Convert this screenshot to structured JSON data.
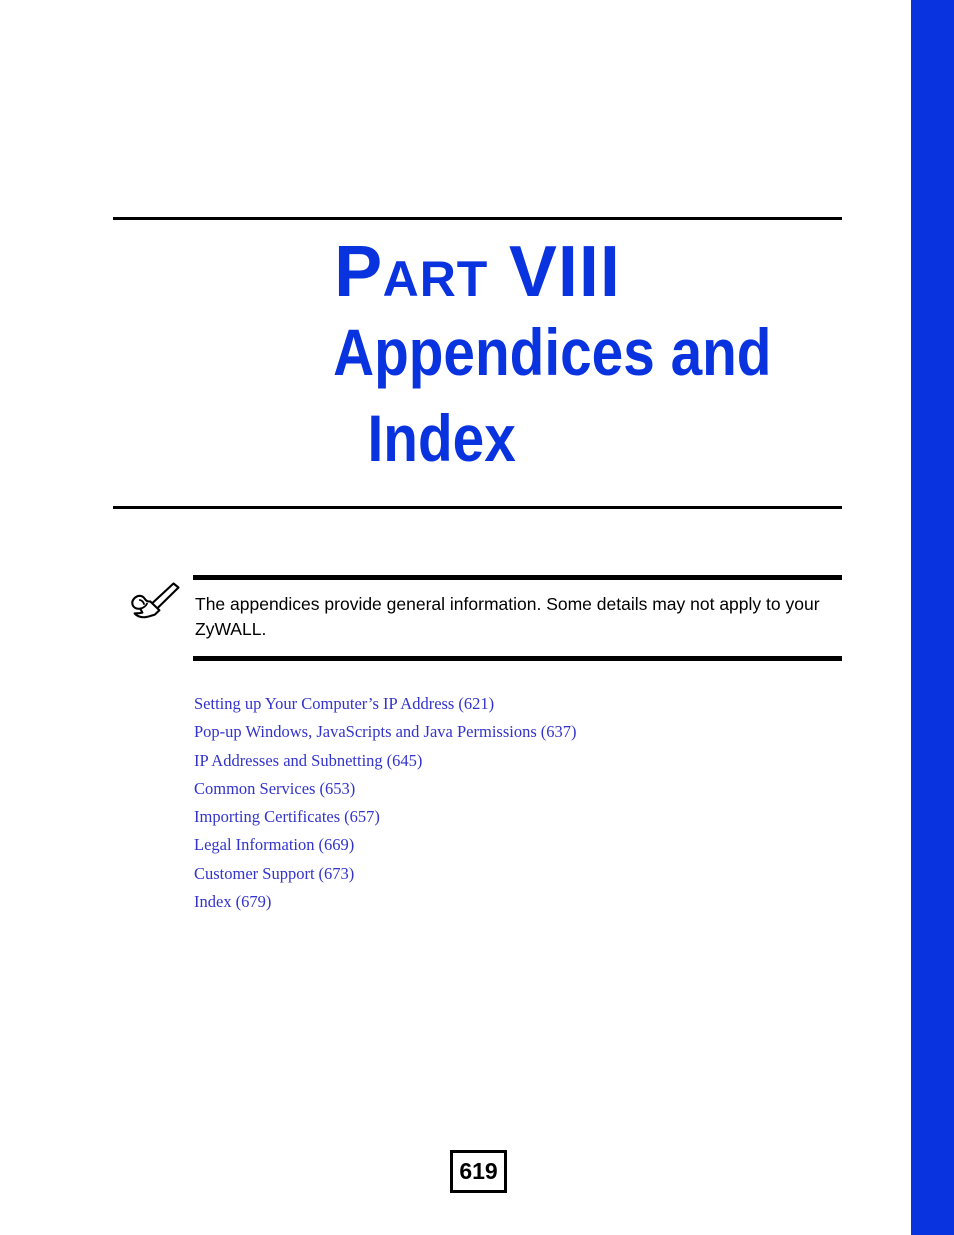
{
  "theme": {
    "accent_blue": "#0A33E0",
    "link_blue": "#3333CC",
    "rule_black": "#000000",
    "page_background": "#FFFFFF"
  },
  "part": {
    "label_lead": "P",
    "label_rest": "ART",
    "number": "VIII",
    "title_line_1": "Appendices and",
    "title_line_2": "Index"
  },
  "note": {
    "icon": "writing-hand-icon",
    "text": "The appendices provide general information. Some details may not apply to your ZyWALL."
  },
  "links": [
    {
      "label": "Setting up Your Computer’s IP Address",
      "page": "(621)"
    },
    {
      "label": "Pop-up Windows, JavaScripts and Java Permissions",
      "page": "(637)"
    },
    {
      "label": "IP Addresses and Subnetting",
      "page": "(645)"
    },
    {
      "label": "Common Services",
      "page": "(653)"
    },
    {
      "label": "Importing Certificates",
      "page": "(657)"
    },
    {
      "label": "Legal Information",
      "page": "(669)"
    },
    {
      "label": "Customer Support",
      "page": "(673)"
    },
    {
      "label": "Index",
      "page": "(679)"
    }
  ],
  "footer": {
    "page_number": "619"
  }
}
